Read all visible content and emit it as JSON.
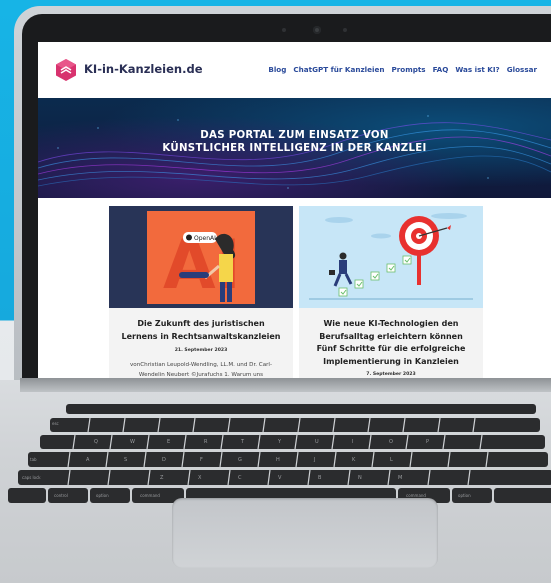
{
  "site": {
    "logo_text": "KI-in-Kanzleien.de",
    "nav": [
      "Blog",
      "ChatGPT für Kanzleien",
      "Prompts",
      "FAQ",
      "Was ist KI?",
      "Glossar"
    ]
  },
  "hero": {
    "line1": "DAS PORTAL ZUM EINSATZ VON",
    "line2": "KÜNSTLICHER INTELLIGENZ IN DER KANZLEI"
  },
  "cards": [
    {
      "image_badge": "OpenAI",
      "image_letters": "AI",
      "title": "Die Zukunft des juristischen Lernens in Rechtsanwaltskanzleien",
      "date": "21. September 2023",
      "excerpt": "vonChristian Leupold-Wendling, LL.M. und Dr. Carl-Wendelin Neubert ©Jurafuchs 1. Warum uns"
    },
    {
      "title": "Wie neue KI-Technologien den Berufsalltag erleichtern können Fünf Schritte für die erfolgreiche Implementierung in Kanzleien",
      "date": "7. September 2023"
    }
  ],
  "colors": {
    "background_blue": "#17b4e6",
    "logo_text": "#2a2f55",
    "nav_link": "#2a4a9a",
    "hero_dark": "#0b2b4e"
  },
  "keyboard": {
    "labels": [
      "control",
      "option",
      "command",
      "command",
      "option",
      "tab",
      "caps lock",
      "esc",
      "Z",
      "X",
      "C",
      "V",
      "B",
      "N",
      "M",
      "A",
      "S",
      "D",
      "F",
      "G",
      "H",
      "J",
      "K",
      "L",
      "Q",
      "W",
      "E",
      "R",
      "T",
      "Y",
      "U",
      "I",
      "O",
      "P"
    ]
  }
}
